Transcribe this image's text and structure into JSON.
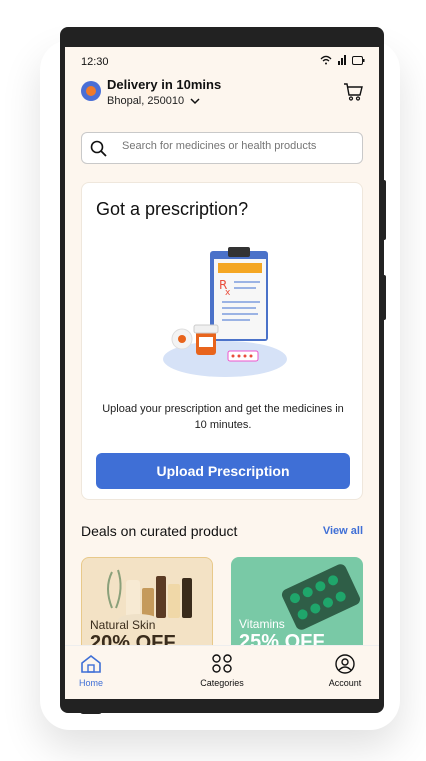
{
  "status": {
    "time": "12:30"
  },
  "header": {
    "delivery": "Delivery in 10mins",
    "address": "Bhopal, 250010"
  },
  "search": {
    "placeholder": "Search for medicines or health products"
  },
  "prescription": {
    "title": "Got a prescription?",
    "description": "Upload your prescription and get the medicines in 10 minutes.",
    "button": "Upload Prescription"
  },
  "deals": {
    "title": "Deals on curated product",
    "view_all": "View all",
    "items": [
      {
        "name": "Natural Skin",
        "discount": "20% OFF"
      },
      {
        "name": "Vitamins",
        "discount": "25% OFF"
      }
    ]
  },
  "nav": {
    "items": [
      {
        "label": "Home"
      },
      {
        "label": "Categories"
      },
      {
        "label": "Account"
      }
    ]
  },
  "colors": {
    "accent": "#3f6fd6",
    "background": "#fdf6ee",
    "deal_green": "#79c9a6",
    "deal_beige": "#f3e2c5"
  }
}
